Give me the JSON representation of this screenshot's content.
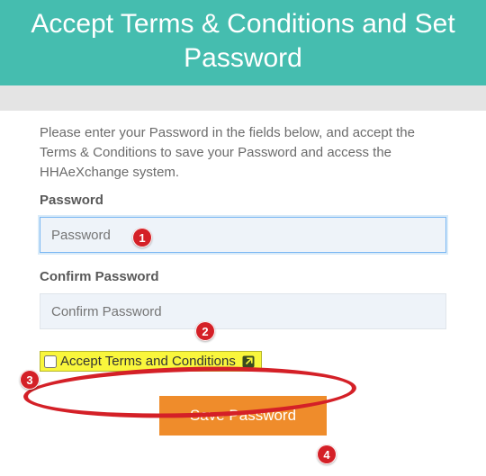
{
  "header": {
    "title": "Accept Terms & Conditions and Set Password"
  },
  "intro_text": "Please enter your Password in the fields below, and accept the Terms & Conditions to save your Password and access the HHAeXchange system.",
  "fields": {
    "password": {
      "label": "Password",
      "placeholder": "Password",
      "value": ""
    },
    "confirm_password": {
      "label": "Confirm Password",
      "placeholder": "Confirm Password",
      "value": ""
    }
  },
  "terms": {
    "checkbox_label": "Accept Terms and Conditions",
    "checked": false
  },
  "buttons": {
    "save": "Save Password"
  },
  "callouts": {
    "c1": "1",
    "c2": "2",
    "c3": "3",
    "c4": "4"
  },
  "colors": {
    "header_bg": "#45bdaf",
    "button_bg": "#ef8c2b",
    "highlight": "#f9f63c",
    "callout": "#d42027"
  }
}
